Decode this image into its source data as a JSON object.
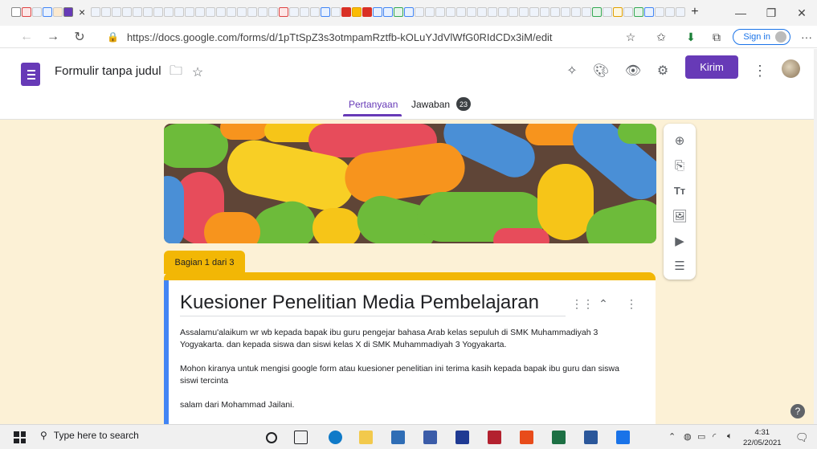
{
  "browser": {
    "active_tab_close": "×",
    "new_tab": "+",
    "url": "https://docs.google.com/forms/d/1pTtSpZ3s3otmpamRztfb-kOLuYJdVlWfG0RIdCDx3iM/edit",
    "signin_label": "Sign in",
    "more": "···"
  },
  "header": {
    "form_title": "Formulir tanpa judul",
    "send_label": "Kirim",
    "tabs": [
      {
        "label": "Pertanyaan",
        "active": true
      },
      {
        "label": "Jawaban",
        "count": "23"
      }
    ]
  },
  "section": {
    "badge": "Bagian 1 dari 3",
    "title": "Kuesioner Penelitian Media Pembelajaran",
    "description": [
      "Assalamu'alaikum wr wb kepada bapak ibu guru pengejar bahasa Arab kelas sepuluh di SMK Muhammadiyah 3 Yogyakarta. dan kepada siswa dan siswi kelas X di SMK Muhammadiyah  3 Yogyakarta.",
      "Mohon kiranya untuk mengisi google form atau kuesioner penelitian ini terima kasih kepada bapak ibu guru dan siswa siswi tercinta",
      "salam dari Mohammad Jailani."
    ]
  },
  "taskbar": {
    "search_placeholder": "Type here to search",
    "time": "4:31",
    "date": "22/05/2021"
  },
  "colors": {
    "accent": "#673ab7",
    "page_bg": "#fcf1d6",
    "section_yellow": "#f2b705"
  }
}
